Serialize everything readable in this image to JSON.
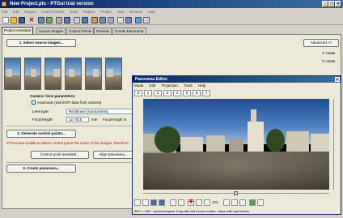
{
  "window": {
    "title": "New Project.pts - PTGui trial version"
  },
  "menubar": [
    "File",
    "Edit",
    "Images",
    "Control Points",
    "Tools",
    "Plugins",
    "Project",
    "View",
    "Window",
    "Help"
  ],
  "tabs": [
    "Project Assistant",
    "Source Images",
    "Control Points",
    "Preview",
    "Create Panorama"
  ],
  "assistant": {
    "step1": "1. Select source images...",
    "advanced": "Advanced >>",
    "rotate1": "rotate",
    "rotate2": "rotate",
    "camera_heading": "Camera / lens parameters:",
    "auto_exif": "Automatic (use EXIF data from camera)",
    "lens_type_label": "Lens type:",
    "lens_type_value": "Rectilinear (normal lens)",
    "focal_label": "Focal length:",
    "focal_value": "12.7015",
    "focal_unit": "mm",
    "focal_mult": "Focal length m",
    "step2": "2. Generate control points...",
    "warning": "PTGui was unable to detect control points for some of the images, therefore",
    "cp_assistant": "Control point assistant...",
    "align": "Align panorama...",
    "step3": "3. Create panorama..."
  },
  "editor": {
    "title": "Panorama Editor",
    "menu": [
      "Mode",
      "Edit",
      "Projection",
      "Tools",
      "Help"
    ],
    "nums": [
      "0",
      "1",
      "2",
      "3",
      "4",
      "5",
      "6",
      "7"
    ],
    "zoom": "123",
    "status": "360° x 180°, equirectangular     Drag with left mouse button, rotate with right button"
  },
  "colors": {
    "titlebar": "#0a246a",
    "warning": "#cc0000"
  }
}
